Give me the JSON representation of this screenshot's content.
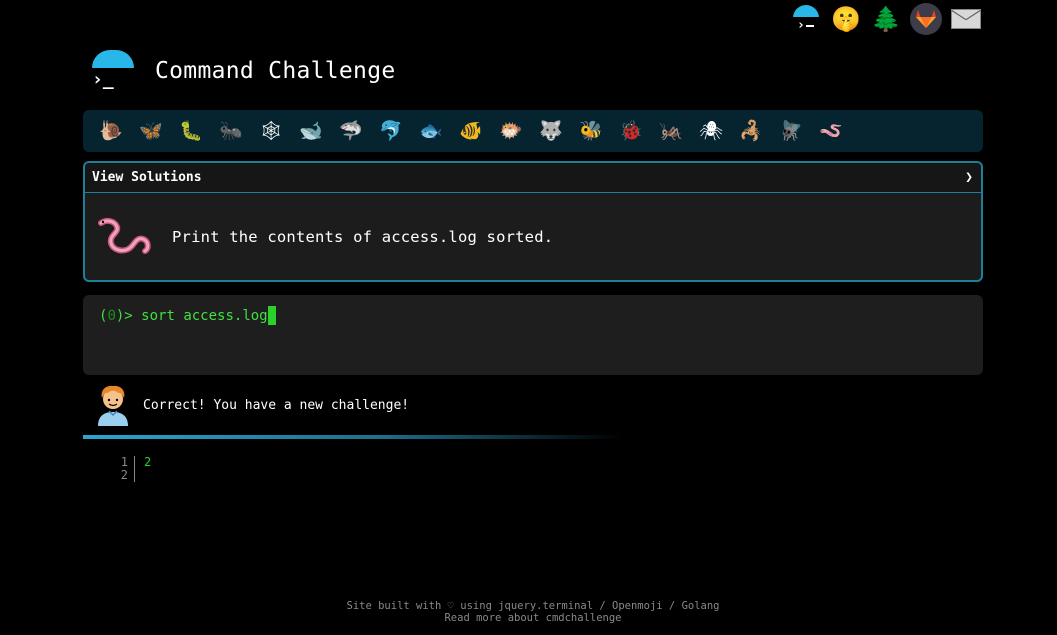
{
  "top_links": [
    {
      "name": "cmdchallenge-logo-icon"
    },
    {
      "name": "shushing-face-icon",
      "glyph": "🤫"
    },
    {
      "name": "tree-icon",
      "glyph": "🌲"
    },
    {
      "name": "gitlab-icon"
    },
    {
      "name": "mail-icon"
    }
  ],
  "header": {
    "logo_prompt": "›_",
    "title": "Command Challenge"
  },
  "challenge_icons": [
    {
      "name": "snail-icon",
      "glyph": "🐌"
    },
    {
      "name": "butterfly-icon",
      "glyph": "🦋"
    },
    {
      "name": "caterpillar-icon",
      "glyph": "🐛"
    },
    {
      "name": "ant-icon",
      "glyph": "🐜"
    },
    {
      "name": "spider-web-icon",
      "glyph": "🕸"
    },
    {
      "name": "whale-icon",
      "glyph": "🐋"
    },
    {
      "name": "shark-icon",
      "glyph": "🦈"
    },
    {
      "name": "dolphin-icon",
      "glyph": "🐬"
    },
    {
      "name": "fish-icon",
      "glyph": "🐟"
    },
    {
      "name": "tropical-fish-icon",
      "glyph": "🐠"
    },
    {
      "name": "blowfish-icon",
      "glyph": "🐡"
    },
    {
      "name": "wolf-icon",
      "glyph": "🐺"
    },
    {
      "name": "bee-icon",
      "glyph": "🐝"
    },
    {
      "name": "ladybug-icon",
      "glyph": "🐞"
    },
    {
      "name": "cricket-icon",
      "glyph": "🦗"
    },
    {
      "name": "spider-icon",
      "glyph": "🕷"
    },
    {
      "name": "scorpion-icon",
      "glyph": "🦂"
    },
    {
      "name": "fly-icon",
      "glyph": "🪰"
    },
    {
      "name": "worm-icon",
      "glyph": "🪱"
    }
  ],
  "solutions": {
    "label": "View Solutions",
    "chevron": "❯",
    "challenge_text": "Print the contents of access.log sorted."
  },
  "terminal": {
    "prompt_open": "(",
    "prompt_num": "0",
    "prompt_close": ")> ",
    "command": "sort access.log"
  },
  "feedback": {
    "text": "Correct! You have a new challenge!"
  },
  "progress": {
    "fraction": 0.6
  },
  "output": {
    "lines": [
      {
        "num": "1",
        "text": "2"
      },
      {
        "num": "2",
        "text": ""
      }
    ]
  },
  "footer": {
    "line1_prefix": "Site built with ♡ using ",
    "link_jquery": "jquery.terminal",
    "slash1": " / ",
    "link_openmoji": "Openmoji",
    "slash2": " / ",
    "link_golang": "Golang",
    "line2": "Read more about cmdchallenge"
  }
}
